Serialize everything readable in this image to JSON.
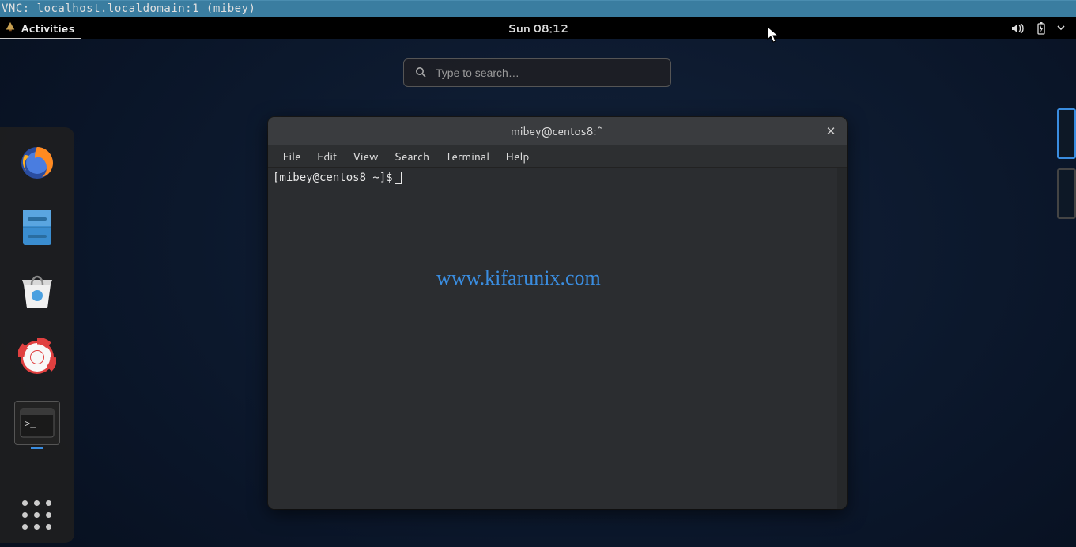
{
  "vnc": {
    "title": "VNC: localhost.localdomain:1 (mibey)"
  },
  "topbar": {
    "activities": "Activities",
    "clock": "Sun 08:12"
  },
  "search": {
    "placeholder": "Type to search…"
  },
  "dock": {
    "items": [
      {
        "name": "firefox"
      },
      {
        "name": "files"
      },
      {
        "name": "software"
      },
      {
        "name": "help"
      },
      {
        "name": "terminal",
        "running": true
      }
    ]
  },
  "window": {
    "title": "mibey@centos8:~",
    "menu": [
      "File",
      "Edit",
      "View",
      "Search",
      "Terminal",
      "Help"
    ],
    "prompt": "[mibey@centos8 ~]$"
  },
  "watermark": "www.kifarunix.com"
}
